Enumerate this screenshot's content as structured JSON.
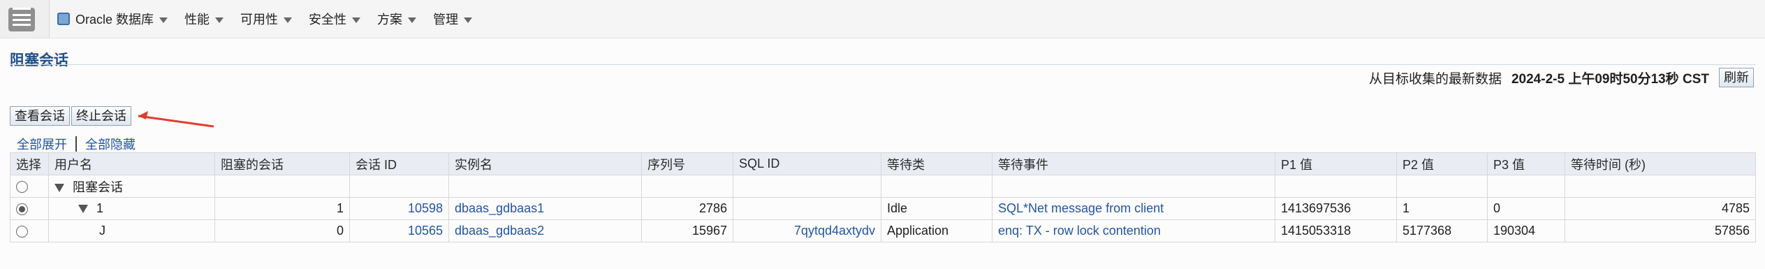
{
  "menu": [
    {
      "label": "Oracle 数据库"
    },
    {
      "label": "性能"
    },
    {
      "label": "可用性"
    },
    {
      "label": "安全性"
    },
    {
      "label": "方案"
    },
    {
      "label": "管理"
    }
  ],
  "page": {
    "title": "阻塞会话",
    "latest_label": "从目标收集的最新数据",
    "latest_time": "2024-2-5 上午09时50分13秒 CST",
    "refresh_button": "刷新"
  },
  "actions": {
    "view_session": "查看会话",
    "terminate_session": "终止会话",
    "expand_all": "全部展开",
    "collapse_all": "全部隐藏"
  },
  "table": {
    "headers": [
      "选择",
      "用户名",
      "阻塞的会话",
      "会话 ID",
      "实例名",
      "序列号",
      "SQL ID",
      "等待类",
      "等待事件",
      "P1 值",
      "P2 值",
      "P3 值",
      "等待时间 (秒)"
    ],
    "rows": [
      [
        "",
        "阻塞会话",
        "",
        "",
        "",
        "",
        "",
        "",
        "",
        "",
        "",
        "",
        ""
      ],
      [
        "",
        "1",
        "1",
        "10598",
        "dbaas_gdbaas1",
        "2786",
        "",
        "Idle",
        "SQL*Net message from client",
        "1413697536",
        "1",
        "0",
        "4785"
      ],
      [
        "",
        "J",
        "0",
        "10565",
        "dbaas_gdbaas2",
        "15967",
        "7qytqd4axtydv",
        "Application",
        "enq: TX - row lock contention",
        "1415053318",
        "5177368",
        "190304",
        "57856"
      ]
    ]
  }
}
